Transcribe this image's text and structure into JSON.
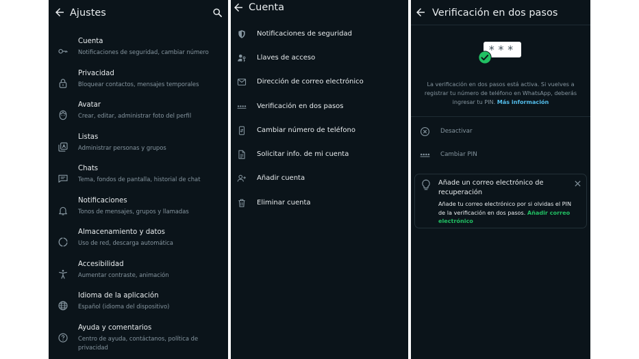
{
  "settings": {
    "title": "Ajustes",
    "items": [
      {
        "title": "Cuenta",
        "subtitle": "Notificaciones de seguridad, cambiar número",
        "icon": "key-icon"
      },
      {
        "title": "Privacidad",
        "subtitle": "Bloquear contactos, mensajes temporales",
        "icon": "lock-icon"
      },
      {
        "title": "Avatar",
        "subtitle": "Crear, editar, administrar foto del perfil",
        "icon": "avatar-icon"
      },
      {
        "title": "Listas",
        "subtitle": "Administrar personas y grupos",
        "icon": "lists-icon"
      },
      {
        "title": "Chats",
        "subtitle": "Tema, fondos de pantalla, historial de chat",
        "icon": "chat-icon"
      },
      {
        "title": "Notificaciones",
        "subtitle": "Tonos de mensajes, grupos y llamadas",
        "icon": "bell-icon"
      },
      {
        "title": "Almacenamiento y datos",
        "subtitle": "Uso de red, descarga automática",
        "icon": "storage-icon"
      },
      {
        "title": "Accesibilidad",
        "subtitle": "Aumentar contraste, animación",
        "icon": "accessibility-icon"
      },
      {
        "title": "Idioma de la aplicación",
        "subtitle": "Español (idioma del dispositivo)",
        "icon": "globe-icon"
      },
      {
        "title": "Ayuda y comentarios",
        "subtitle": "Centro de ayuda, contáctanos, política de privacidad",
        "icon": "help-icon"
      }
    ]
  },
  "account": {
    "title": "Cuenta",
    "items": [
      {
        "label": "Notificaciones de seguridad",
        "icon": "shield-icon"
      },
      {
        "label": "Llaves de acceso",
        "icon": "passkey-icon"
      },
      {
        "label": "Dirección de correo electrónico",
        "icon": "email-icon"
      },
      {
        "label": "Verificación en dos pasos",
        "icon": "pin-dots-icon"
      },
      {
        "label": "Cambiar número de teléfono",
        "icon": "phone-change-icon"
      },
      {
        "label": "Solicitar info. de mi cuenta",
        "icon": "document-icon"
      },
      {
        "label": "Añadir cuenta",
        "icon": "add-person-icon"
      },
      {
        "label": "Eliminar cuenta",
        "icon": "trash-icon"
      }
    ]
  },
  "two_step": {
    "title": "Verificación en dos pasos",
    "hero_text": "***",
    "description": "La verificación en dos pasos está activa. Si vuelves a registrar tu número de teléfono en WhatsApp, deberás ingresar tu PIN.",
    "more_info": "Más información",
    "options": [
      {
        "label": "Desactivar",
        "icon": "disable-icon"
      },
      {
        "label": "Cambiar PIN",
        "icon": "pin-dots-icon"
      }
    ],
    "card": {
      "title": "Añade un correo electrónico de recuperación",
      "text": "Añade tu correo electrónico por si olvidas el PIN de la verificación en dos pasos.",
      "link": "Añadir correo electrónico",
      "icon": "lightbulb-icon"
    }
  },
  "colors": {
    "background": "#0b141a",
    "primary_text": "#e9edef",
    "secondary_text": "#8696a0",
    "blue_link": "#53bdeb",
    "green_accent": "#21c063"
  }
}
